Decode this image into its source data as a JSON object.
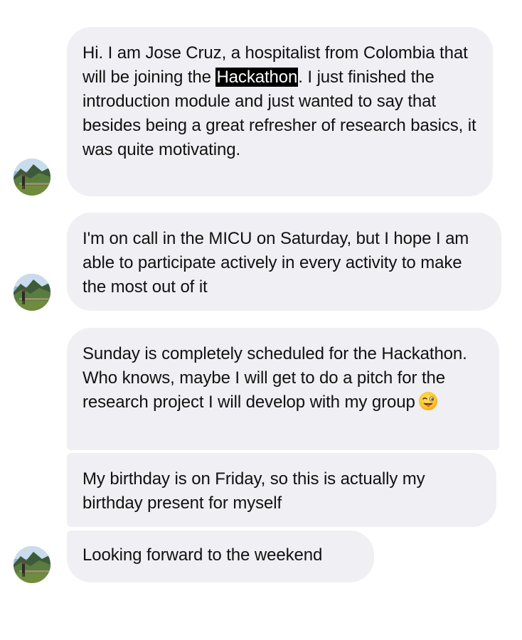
{
  "conversation": {
    "messages": [
      {
        "text_before": "Hi. I am Jose Cruz, a hospitalist from Colombia that will be joining the ",
        "highlighted": "Hackathon",
        "text_after": ". I just finished the introduction module and just wanted to say that besides being a great refresher of research basics, it was quite motivating."
      },
      {
        "text": "I'm on call in the MICU on Saturday, but I hope I am able to participate actively in every activity to make the most out of it"
      },
      {
        "text": "Sunday is completely scheduled for the Hackathon. Who knows, maybe I will get to do a pitch for the research project I will develop with my group",
        "emoji": "winking-face-with-tongue-icon"
      },
      {
        "text": "My birthday is on Friday, so this is actually my birthday present for myself"
      },
      {
        "text": "Looking forward to the weekend"
      }
    ]
  },
  "colors": {
    "bubble_background": "#efeff4",
    "text": "#111111",
    "highlight_background": "#000000",
    "highlight_text": "#ffffff"
  }
}
